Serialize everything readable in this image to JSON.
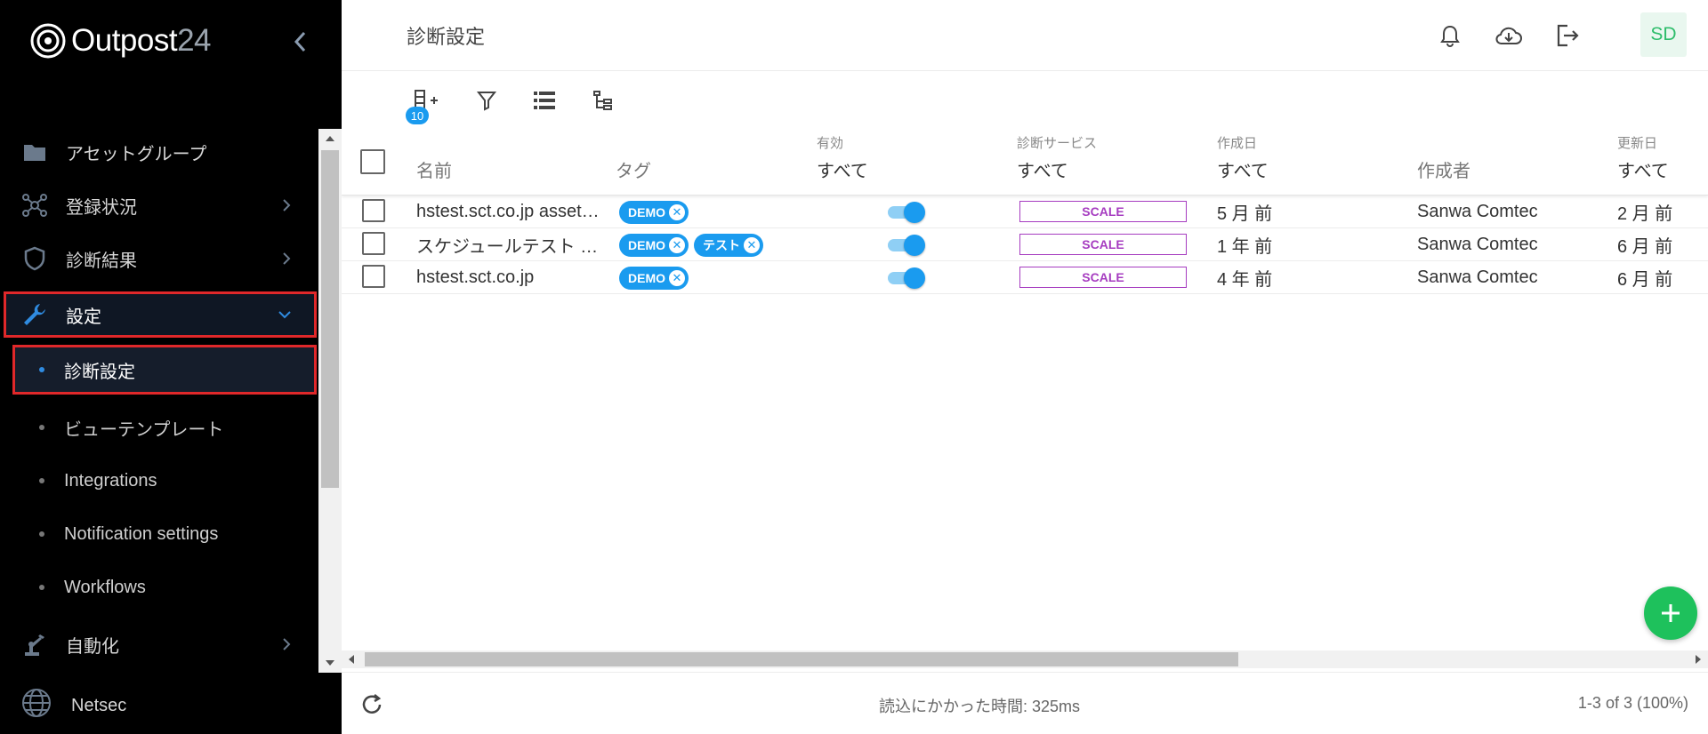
{
  "app": {
    "logo_text": "Outpost",
    "logo_num": "24"
  },
  "sidebar": {
    "items": [
      {
        "label": "アセットグループ",
        "icon": "folder-icon"
      },
      {
        "label": "登録状況",
        "icon": "network-icon"
      },
      {
        "label": "診断結果",
        "icon": "shield-icon"
      },
      {
        "label": "設定",
        "icon": "wrench-icon"
      }
    ],
    "sub_items": [
      {
        "label": "診断設定"
      },
      {
        "label": "ビューテンプレート"
      },
      {
        "label": "Integrations"
      },
      {
        "label": "Notification settings"
      },
      {
        "label": "Workflows"
      }
    ],
    "automation": {
      "label": "自動化",
      "icon": "robot-arm-icon"
    },
    "netsec": {
      "label": "Netsec",
      "icon": "globe-icon"
    }
  },
  "header": {
    "title": "診断設定",
    "avatar": "SD"
  },
  "toolbar": {
    "column_badge": "10"
  },
  "table": {
    "columns": {
      "name": "名前",
      "tag": "タグ",
      "enabled_label": "有効",
      "enabled_filter": "すべて",
      "service_label": "診断サービス",
      "service_filter": "すべて",
      "created_label": "作成日",
      "created_filter": "すべて",
      "creator": "作成者",
      "updated_label": "更新日",
      "updated_filter": "すべて"
    },
    "rows": [
      {
        "name": "hstest.sct.co.jp asset…",
        "tags": [
          "DEMO"
        ],
        "service": "SCALE",
        "created": "5 月 前",
        "creator": "Sanwa Comtec",
        "updated": "2 月 前"
      },
      {
        "name": "スケジュールテスト …",
        "tags": [
          "DEMO",
          "テスト"
        ],
        "service": "SCALE",
        "created": "1 年 前",
        "creator": "Sanwa Comtec",
        "updated": "6 月 前"
      },
      {
        "name": "hstest.sct.co.jp",
        "tags": [
          "DEMO"
        ],
        "service": "SCALE",
        "created": "4 年 前",
        "creator": "Sanwa Comtec",
        "updated": "6 月 前"
      }
    ]
  },
  "footer": {
    "load_time": "読込にかかった時間: 325ms",
    "count": "1-3 of 3 (100%)"
  },
  "colors": {
    "accent": "#1a9bef",
    "fab": "#1ec15c",
    "service": "#a63cc0",
    "highlight": "#e0282a"
  }
}
